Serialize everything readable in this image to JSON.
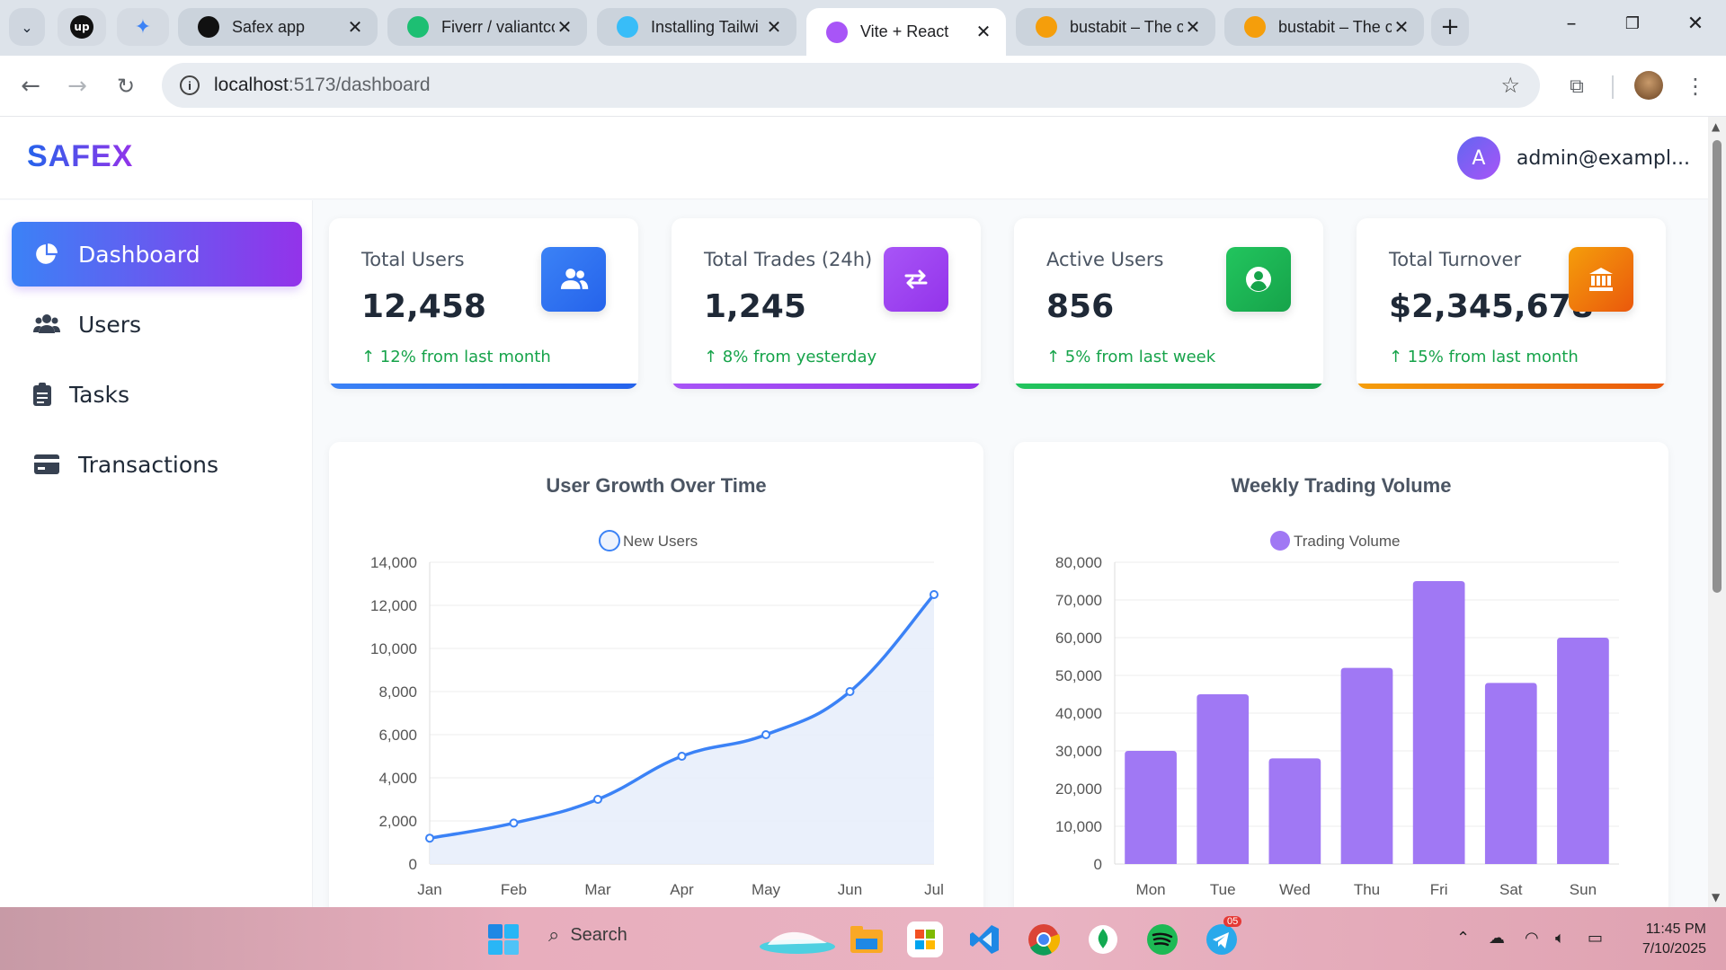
{
  "browser": {
    "tabs": [
      {
        "title": "Safex app",
        "icon": "safex-favicon",
        "color": "#111111"
      },
      {
        "title": "Fiverr / valiantcc",
        "icon": "fiverr-favicon",
        "color": "#1dbf73"
      },
      {
        "title": "Installing Tailwi",
        "icon": "tailwind-favicon",
        "color": "#38bdf8"
      },
      {
        "title": "Vite + React",
        "icon": "vite-favicon",
        "color": "#a855f7",
        "active": true
      },
      {
        "title": "bustabit – The c",
        "icon": "bustabit-favicon",
        "color": "#f59e0b"
      },
      {
        "title": "bustabit – The c",
        "icon": "bustabit-favicon",
        "color": "#f59e0b"
      }
    ],
    "url_host": "localhost",
    "url_path": ":5173/dashboard"
  },
  "app": {
    "logo": "SAFEX",
    "user_initial": "A",
    "user_email": "admin@exampl...",
    "brand_gradient": [
      "#2563eb",
      "#9333ea"
    ]
  },
  "sidebar": {
    "items": [
      {
        "label": "Dashboard",
        "icon": "pie-chart-icon",
        "active": true
      },
      {
        "label": "Users",
        "icon": "users-icon"
      },
      {
        "label": "Tasks",
        "icon": "clipboard-icon"
      },
      {
        "label": "Transactions",
        "icon": "credit-card-icon"
      }
    ]
  },
  "stats": [
    {
      "label": "Total Users",
      "value": "12,458",
      "trend": "↑ 12% from last month",
      "icon": "users-icon",
      "color": "#2563eb",
      "color2": "#3b82f6"
    },
    {
      "label": "Total Trades (24h)",
      "value": "1,245",
      "trend": "↑ 8% from yesterday",
      "icon": "swap-arrows-icon",
      "color": "#9333ea",
      "color2": "#a855f7"
    },
    {
      "label": "Active Users",
      "value": "856",
      "trend": "↑ 5% from last week",
      "icon": "user-circle-icon",
      "color": "#16a34a",
      "color2": "#22c55e"
    },
    {
      "label": "Total Turnover",
      "value": "$2,345,678",
      "trend": "↑ 15% from last month",
      "icon": "bank-icon",
      "color": "#ea580c",
      "color2": "#f59e0b"
    }
  ],
  "chart_data": [
    {
      "type": "line",
      "title": "User Growth Over Time",
      "categories": [
        "Jan",
        "Feb",
        "Mar",
        "Apr",
        "May",
        "Jun",
        "Jul"
      ],
      "series": [
        {
          "name": "New Users",
          "values": [
            1200,
            1900,
            3000,
            5000,
            6000,
            8000,
            12500
          ],
          "color": "#3b82f6"
        }
      ],
      "ylim": [
        0,
        14000
      ],
      "yticks": [
        0,
        2000,
        4000,
        6000,
        8000,
        10000,
        12000,
        14000
      ],
      "ytick_labels": [
        "0",
        "2,000",
        "4,000",
        "6,000",
        "8,000",
        "10,000",
        "12,000",
        "14,000"
      ],
      "fill": true,
      "legend": "top-center",
      "grid": true
    },
    {
      "type": "bar",
      "title": "Weekly Trading Volume",
      "categories": [
        "Mon",
        "Tue",
        "Wed",
        "Thu",
        "Fri",
        "Sat",
        "Sun"
      ],
      "series": [
        {
          "name": "Trading Volume",
          "values": [
            30000,
            45000,
            28000,
            52000,
            75000,
            48000,
            60000
          ],
          "color": "#a078f4"
        }
      ],
      "ylim": [
        0,
        80000
      ],
      "yticks": [
        0,
        10000,
        20000,
        30000,
        40000,
        50000,
        60000,
        70000,
        80000
      ],
      "ytick_labels": [
        "0",
        "10,000",
        "20,000",
        "30,000",
        "40,000",
        "50,000",
        "60,000",
        "70,000",
        "80,000"
      ],
      "legend": "top-center",
      "grid": true
    }
  ],
  "taskbar": {
    "search_label": "Search",
    "telegram_badge": "05",
    "time": "11:45 PM",
    "date": "7/10/2025"
  }
}
